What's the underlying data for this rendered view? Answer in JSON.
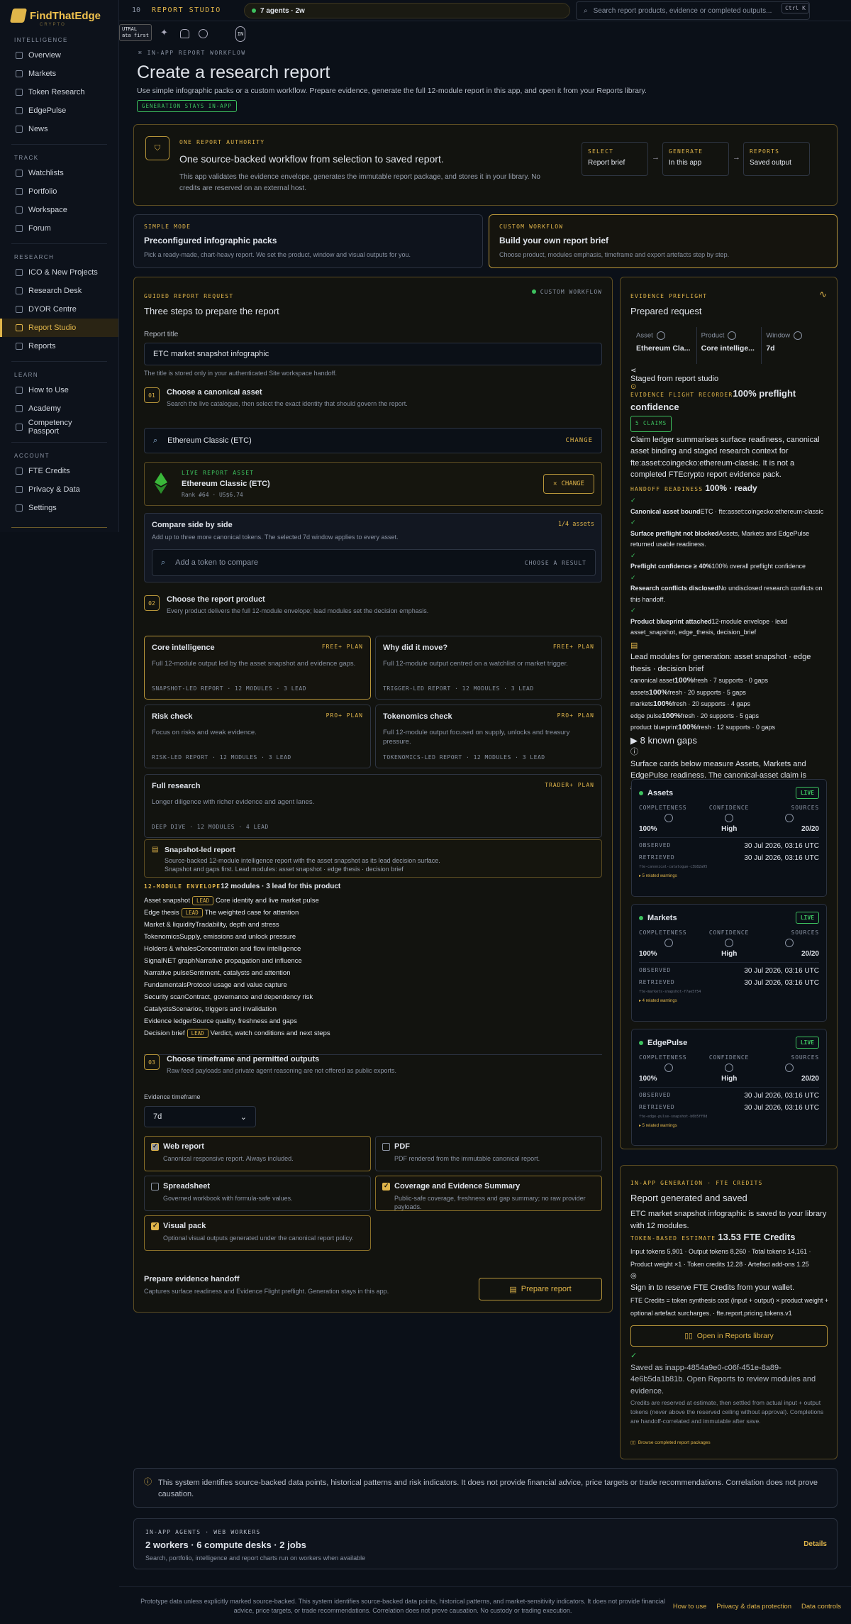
{
  "brand": {
    "name": "FindThatEdge",
    "tagline": "CRYPTO"
  },
  "sidebar": {
    "sections": [
      {
        "title": "INTELLIGENCE",
        "items": [
          "Overview",
          "Markets",
          "Token Research",
          "EdgePulse",
          "News"
        ]
      },
      {
        "title": "TRACK",
        "items": [
          "Watchlists",
          "Portfolio",
          "Workspace",
          "Forum"
        ]
      },
      {
        "title": "RESEARCH",
        "items": [
          "ICO & New Projects",
          "Research Desk",
          "DYOR Centre",
          "Report Studio",
          "Reports"
        ]
      },
      {
        "title": "LEARN",
        "items": [
          "How to Use",
          "Academy",
          "Competency Passport"
        ]
      },
      {
        "title": "ACCOUNT",
        "items": [
          "FTE Credits",
          "Privacy & Data",
          "Settings"
        ]
      }
    ],
    "active": "Report Studio"
  },
  "topbar": {
    "page_num": "10",
    "section": "REPORT STUDIO",
    "agents": "7 agents · 2w",
    "search_placeholder": "Search report products, evidence or completed outputs...",
    "kbd": "Ctrl K",
    "neutral_top": "UTRAL",
    "neutral_bottom": "ata first",
    "avatar": "IN"
  },
  "header": {
    "eyebrow": "IN-APP REPORT WORKFLOW",
    "title": "Create a research report",
    "subtitle": "Use simple infographic packs or a custom workflow. Prepare evidence, generate the full 12-module report in this app, and open it from your Reports library.",
    "badge": "GENERATION STAYS IN-APP"
  },
  "authority": {
    "label": "ONE REPORT AUTHORITY",
    "title": "One source-backed workflow from selection to saved report.",
    "desc": "This app validates the evidence envelope, generates the immutable report package, and stores it in your library. No credits are reserved on an external host.",
    "steps": [
      {
        "k": "SELECT",
        "v": "Report brief"
      },
      {
        "k": "GENERATE",
        "v": "In this app"
      },
      {
        "k": "REPORTS",
        "v": "Saved output"
      }
    ],
    "arrow": "→"
  },
  "modes": [
    {
      "label": "SIMPLE MODE",
      "title": "Preconfigured infographic packs",
      "desc": "Pick a ready-made, chart-heavy report. We set the product, window and visual outputs for you."
    },
    {
      "label": "CUSTOM WORKFLOW",
      "title": "Build your own report brief",
      "desc": "Choose product, modules emphasis, timeframe and export artefacts step by step."
    }
  ],
  "guided": {
    "label": "GUIDED REPORT REQUEST",
    "badge": "CUSTOM WORKFLOW",
    "title": "Three steps to prepare the report",
    "report_title_label": "Report title",
    "report_title_value": "ETC market snapshot infographic",
    "report_title_hint": "The title is stored only in your authenticated Site workspace handoff.",
    "step1": {
      "num": "01",
      "title": "Choose a canonical asset",
      "desc": "Search the live catalogue, then select the exact identity that should govern the report.",
      "asset_field": "Ethereum Classic (ETC)",
      "change": "CHANGE",
      "live_label": "LIVE REPORT ASSET",
      "live_name": "Ethereum Classic (ETC)",
      "live_meta": "Rank #64 · US$6.74",
      "change_btn": "CHANGE",
      "compare_title": "Compare side by side",
      "compare_count": "1/4 assets",
      "compare_desc": "Add up to three more canonical tokens. The selected 7d window applies to every asset.",
      "compare_placeholder": "Add a token to compare",
      "compare_action": "CHOOSE A RESULT"
    },
    "step2": {
      "num": "02",
      "title": "Choose the report product",
      "desc": "Every product delivers the full 12-module envelope; lead modules set the decision emphasis.",
      "products": [
        {
          "title": "Core intelligence",
          "plan": "FREE+ PLAN",
          "desc": "Full 12-module output led by the asset snapshot and evidence gaps.",
          "meta": "SNAPSHOT-LED REPORT · 12 MODULES · 3 LEAD"
        },
        {
          "title": "Why did it move?",
          "plan": "FREE+ PLAN",
          "desc": "Full 12-module output centred on a watchlist or market trigger.",
          "meta": "TRIGGER-LED REPORT · 12 MODULES · 3 LEAD"
        },
        {
          "title": "Risk check",
          "plan": "PRO+ PLAN",
          "desc": "Focus on risks and weak evidence.",
          "meta": "RISK-LED REPORT · 12 MODULES · 3 LEAD"
        },
        {
          "title": "Tokenomics check",
          "plan": "PRO+ PLAN",
          "desc": "Full 12-module output focused on supply, unlocks and treasury pressure.",
          "meta": "TOKENOMICS-LED REPORT · 12 MODULES · 3 LEAD"
        },
        {
          "title": "Full research",
          "plan": "TRADER+ PLAN",
          "desc": "Longer diligence with richer evidence and agent lanes.",
          "meta": "DEEP DIVE · 12 MODULES · 4 LEAD"
        }
      ],
      "selected_title": "Snapshot-led report",
      "selected_desc": "Source-backed 12-module intelligence report with the asset snapshot as its lead decision surface.",
      "selected_desc2": "Snapshot and gaps first. Lead modules: asset snapshot · edge thesis · decision brief",
      "envelope_label": "12-MODULE ENVELOPE",
      "envelope_summary": "12 modules · 3 lead for this product",
      "lead_tag": "LEAD",
      "modules": [
        {
          "name": "Asset snapshot",
          "lead": true,
          "desc": "Core identity and live market pulse"
        },
        {
          "name": "Edge thesis",
          "lead": true,
          "desc": "The weighted case for attention"
        },
        {
          "name": "Market & liquidity",
          "lead": false,
          "desc": "Tradability, depth and stress"
        },
        {
          "name": "Tokenomics",
          "lead": false,
          "desc": "Supply, emissions and unlock pressure"
        },
        {
          "name": "Holders & whales",
          "lead": false,
          "desc": "Concentration and flow intelligence"
        },
        {
          "name": "SignalNET graph",
          "lead": false,
          "desc": "Narrative propagation and influence"
        },
        {
          "name": "Narrative pulse",
          "lead": false,
          "desc": "Sentiment, catalysts and attention"
        },
        {
          "name": "Fundamentals",
          "lead": false,
          "desc": "Protocol usage and value capture"
        },
        {
          "name": "Security scan",
          "lead": false,
          "desc": "Contract, governance and dependency risk"
        },
        {
          "name": "Catalysts",
          "lead": false,
          "desc": "Scenarios, triggers and invalidation"
        },
        {
          "name": "Evidence ledger",
          "lead": false,
          "desc": "Source quality, freshness and gaps"
        },
        {
          "name": "Decision brief",
          "lead": true,
          "desc": "Verdict, watch conditions and next steps"
        }
      ]
    },
    "step3": {
      "num": "03",
      "title": "Choose timeframe and permitted outputs",
      "desc": "Raw feed payloads and private agent reasoning are not offered as public exports.",
      "timeframe_label": "Evidence timeframe",
      "timeframe_value": "7d",
      "outputs": [
        {
          "title": "Web report",
          "desc": "Canonical responsive report. Always included.",
          "state": "grey"
        },
        {
          "title": "PDF",
          "desc": "PDF rendered from the immutable canonical report.",
          "state": "off"
        },
        {
          "title": "Spreadsheet",
          "desc": "Governed workbook with formula-safe values.",
          "state": "off"
        },
        {
          "title": "Coverage and Evidence Summary",
          "desc": "Public-safe coverage, freshness and gap summary; no raw provider payloads.",
          "state": "on"
        },
        {
          "title": "Visual pack",
          "desc": "Optional visual outputs generated under the canonical report policy.",
          "state": "on"
        }
      ]
    },
    "handoff_title": "Prepare evidence handoff",
    "handoff_desc": "Captures surface readiness and Evidence Flight preflight. Generation stays in this app.",
    "prepare_btn": "Prepare report"
  },
  "preflight": {
    "label": "EVIDENCE PREFLIGHT",
    "title": "Prepared request",
    "cols": [
      {
        "k": "Asset",
        "v": "Ethereum Cla..."
      },
      {
        "k": "Product",
        "v": "Core intellige..."
      },
      {
        "k": "Window",
        "v": "7d"
      }
    ],
    "staged": "Staged from report studio",
    "recorder_label": "EVIDENCE FLIGHT RECORDER",
    "recorder_value": "100% preflight confidence",
    "claims": "5 CLAIMS",
    "claims_desc": "Claim ledger summarises surface readiness, canonical asset binding and staged research context for fte:asset:coingecko:ethereum-classic. It is not a completed FTEcrypto report evidence pack.",
    "handoff_label": "HANDOFF READINESS",
    "handoff_value": "100% · ready",
    "checks": [
      {
        "t": "Canonical asset bound",
        "d": "ETC · fte:asset:coingecko:ethereum-classic"
      },
      {
        "t": "Surface preflight not blocked",
        "d": "Assets, Markets and EdgePulse returned usable readiness."
      },
      {
        "t": "Preflight confidence ≥ 40%",
        "d": "100% overall preflight confidence"
      },
      {
        "t": "Research conflicts disclosed",
        "d": "No undisclosed research conflicts on this handoff."
      },
      {
        "t": "Product blueprint attached",
        "d": "12-module envelope · lead asset_snapshot, edge_thesis, decision_brief"
      }
    ],
    "lead_modules": "Lead modules for generation: asset snapshot · edge thesis · decision brief",
    "fresh": [
      {
        "n": "canonical asset",
        "p": "100%",
        "r": "fresh · 7 supports · 0 gaps"
      },
      {
        "n": "assets",
        "p": "100%",
        "r": "fresh · 20 supports · 5 gaps"
      },
      {
        "n": "markets",
        "p": "100%",
        "r": "fresh · 20 supports · 4 gaps"
      },
      {
        "n": "edge pulse",
        "p": "100%",
        "r": "fresh · 20 supports · 5 gaps"
      },
      {
        "n": "product blueprint",
        "p": "100%",
        "r": "fresh · 12 supports · 0 gaps"
      }
    ],
    "known_gaps": "▶ 8 known gaps",
    "surface_note": "Surface cards below measure Assets, Markets and EdgePulse readiness. The canonical-asset claim is asset-scoped identity quality.",
    "surfaces": [
      {
        "name": "Assets",
        "fine": "fte-canonical-catalogue-c3b82a95",
        "warnings": "▸ 5 related warnings"
      },
      {
        "name": "Markets",
        "fine": "fte-markets-snapshot-f7ae5f54",
        "warnings": "▸ 4 related warnings"
      },
      {
        "name": "EdgePulse",
        "fine": "fte-edge-pulse-snapshot-b0b5ff0d",
        "warnings": "▸ 5 related warnings"
      }
    ],
    "surface_common": {
      "live": "LIVE",
      "completeness": "COMPLETENESS",
      "confidence": "CONFIDENCE",
      "sources": "SOURCES",
      "comp_v": "100%",
      "conf_v": "High",
      "src_v": "20/20",
      "observed": "OBSERVED",
      "retrieved": "RETRIEVED",
      "time": "30 Jul 2026, 03:16 UTC"
    }
  },
  "generation": {
    "label": "IN-APP GENERATION · FTE CREDITS",
    "title": "Report generated and saved",
    "desc": "ETC market snapshot infographic is saved to your library with 12 modules.",
    "estimate_label": "TOKEN-BASED ESTIMATE",
    "estimate_value": "13.53 FTE Credits",
    "tokens_line1": "Input tokens 5,901 · Output tokens 8,260 · Total tokens 14,161 · Product weight ×1 · Token credits 12.28 · Artefact add-ons 1.25",
    "signin": "Sign in to reserve FTE Credits from your wallet.",
    "formula": "FTE Credits = token synthesis cost (input + output) × product weight + optional artefact surcharges. · fte.report.pricing.tokens.v1",
    "open_btn": "Open in Reports library",
    "saved": "Saved as inapp-4854a9e0-c06f-451e-8a89-4e6b5da1b81b. Open Reports to review modules and evidence.",
    "fine": "Credits are reserved at estimate, then settled from actual input + output tokens (never above the reserved ceiling without approval). Completions are handoff-correlated and immutable after save.",
    "browse": "Browse completed report packages"
  },
  "disclaimer": "This system identifies source-backed data points, historical patterns and risk indicators. It does not provide financial advice, price targets or trade recommendations. Correlation does not prove causation.",
  "workers": {
    "label": "IN-APP AGENTS · WEB WORKERS",
    "title": "2 workers · 6 compute desks · 2 jobs",
    "desc": "Search, portfolio, intelligence and report charts run on workers when available",
    "details": "Details"
  },
  "footer": {
    "text": "Prototype data unless explicitly marked source-backed. This system identifies source-backed data points, historical patterns, and market-sensitivity indicators. It does not provide financial advice, price targets, or trade recommendations. Correlation does not prove causation. No custody or trading execution.",
    "links": [
      "How to use",
      "Privacy & data protection",
      "Data controls"
    ]
  },
  "colors": {
    "accent": "#e0b54a",
    "live": "#3dc25f",
    "bg": "#0b1018"
  }
}
